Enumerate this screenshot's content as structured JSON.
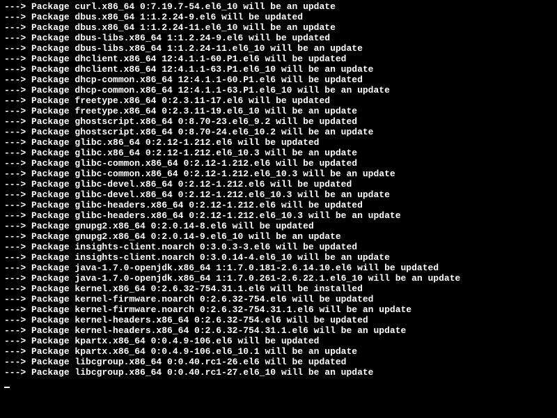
{
  "terminal": {
    "lines": [
      "---> Package curl.x86_64 0:7.19.7-54.el6_10 will be an update",
      "---> Package dbus.x86_64 1:1.2.24-9.el6 will be updated",
      "---> Package dbus.x86_64 1:1.2.24-11.el6_10 will be an update",
      "---> Package dbus-libs.x86_64 1:1.2.24-9.el6 will be updated",
      "---> Package dbus-libs.x86_64 1:1.2.24-11.el6_10 will be an update",
      "---> Package dhclient.x86_64 12:4.1.1-60.P1.el6 will be updated",
      "---> Package dhclient.x86_64 12:4.1.1-63.P1.el6_10 will be an update",
      "---> Package dhcp-common.x86_64 12:4.1.1-60.P1.el6 will be updated",
      "---> Package dhcp-common.x86_64 12:4.1.1-63.P1.el6_10 will be an update",
      "---> Package freetype.x86_64 0:2.3.11-17.el6 will be updated",
      "---> Package freetype.x86_64 0:2.3.11-19.el6_10 will be an update",
      "---> Package ghostscript.x86_64 0:8.70-23.el6_9.2 will be updated",
      "---> Package ghostscript.x86_64 0:8.70-24.el6_10.2 will be an update",
      "---> Package glibc.x86_64 0:2.12-1.212.el6 will be updated",
      "---> Package glibc.x86_64 0:2.12-1.212.el6_10.3 will be an update",
      "---> Package glibc-common.x86_64 0:2.12-1.212.el6 will be updated",
      "---> Package glibc-common.x86_64 0:2.12-1.212.el6_10.3 will be an update",
      "---> Package glibc-devel.x86_64 0:2.12-1.212.el6 will be updated",
      "---> Package glibc-devel.x86_64 0:2.12-1.212.el6_10.3 will be an update",
      "---> Package glibc-headers.x86_64 0:2.12-1.212.el6 will be updated",
      "---> Package glibc-headers.x86_64 0:2.12-1.212.el6_10.3 will be an update",
      "---> Package gnupg2.x86_64 0:2.0.14-8.el6 will be updated",
      "---> Package gnupg2.x86_64 0:2.0.14-9.el6_10 will be an update",
      "---> Package insights-client.noarch 0:3.0.3-3.el6 will be updated",
      "---> Package insights-client.noarch 0:3.0.14-4.el6_10 will be an update",
      "---> Package java-1.7.0-openjdk.x86_64 1:1.7.0.181-2.6.14.10.el6 will be updated",
      "---> Package java-1.7.0-openjdk.x86_64 1:1.7.0.261-2.6.22.1.el6_10 will be an update",
      "---> Package kernel.x86_64 0:2.6.32-754.31.1.el6 will be installed",
      "---> Package kernel-firmware.noarch 0:2.6.32-754.el6 will be updated",
      "---> Package kernel-firmware.noarch 0:2.6.32-754.31.1.el6 will be an update",
      "---> Package kernel-headers.x86_64 0:2.6.32-754.el6 will be updated",
      "---> Package kernel-headers.x86_64 0:2.6.32-754.31.1.el6 will be an update",
      "---> Package kpartx.x86_64 0:0.4.9-106.el6 will be updated",
      "---> Package kpartx.x86_64 0:0.4.9-106.el6_10.1 will be an update",
      "---> Package libcgroup.x86_64 0:0.40.rc1-26.el6 will be updated",
      "---> Package libcgroup.x86_64 0:0.40.rc1-27.el6_10 will be an update"
    ]
  }
}
